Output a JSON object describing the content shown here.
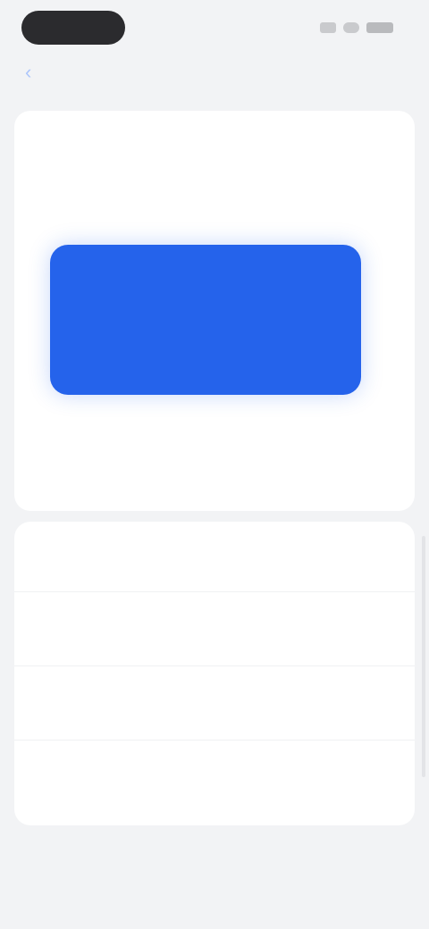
{
  "status_bar": {
    "icons": [
      "signal-icon",
      "wifi-icon",
      "battery-icon"
    ]
  },
  "nav": {
    "title": "",
    "subtitle": "",
    "back_icon": "chevron-left-icon",
    "action_label": ""
  },
  "top_card": {
    "caption": "",
    "title": "",
    "hero_button": {
      "label": "",
      "color": "#2563eb"
    },
    "hero_caption": ""
  },
  "bottom_card": {
    "header": "",
    "action_label": "",
    "rows": [
      {
        "label": "",
        "value": ""
      },
      {
        "label": "",
        "value": ""
      },
      {
        "label": "",
        "value": ""
      }
    ]
  },
  "tab_bar": {
    "tabs": [
      {
        "label": ""
      },
      {
        "label": ""
      },
      {
        "label": ""
      },
      {
        "label": ""
      }
    ]
  },
  "colors": {
    "accent": "#2563eb",
    "background": "#f2f3f5",
    "card": "#ffffff"
  }
}
